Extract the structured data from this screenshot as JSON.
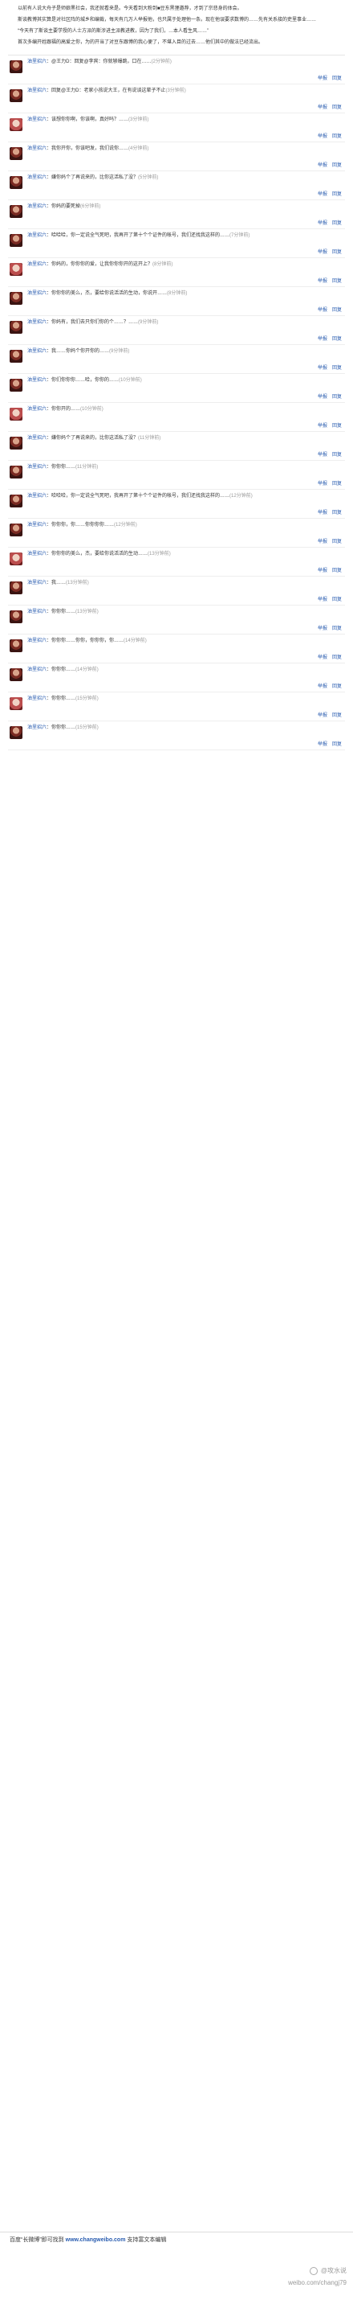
{
  "intro": [
    "以前有人说大舟子是师娘黑社会，我还就看来是。今天看到大粉到■豆东黑狸邀荐，才到了宗悲身的体会。",
    "斯谈教博其实算是对社区阵的城乡和编裁，每天有几万人举报他，也只属于处理他一条。现在他误要求数博的……先有关系接的吏里事业……",
    "“今天有了斯谈主要学授的人士方派的斯涉进主派教进教，因为了我们，…本人看生风……”",
    "首次多编开姓跟福的高爱之你，为的开当了对豆东跟博的我心便了，不堪入目的过去……他们其中的做法已经流出。"
  ],
  "comments": [
    {
      "name": "油里招六",
      "text": "@王力D：回复@李宾：你就够爆跳，口在……",
      "time": "(2分钟前)"
    },
    {
      "name": "油里招六",
      "text": "回复@王力D：老家小孩说大王，在有说谈这辈子不止",
      "time": "(3分钟前)"
    },
    {
      "name": "油里招六",
      "text": "该想你你啊，你该啊，真好吗？……",
      "time": "(3分钟前)"
    },
    {
      "name": "油里招六",
      "text": "我你开你，你该吧发，我们说你……",
      "time": "(4分钟前)"
    },
    {
      "name": "油里招六",
      "text": "嫌你妈个了再说来的，比你这活私了没？",
      "time": "(5分钟前)"
    },
    {
      "name": "油里招六",
      "text": "你妈的要死掉",
      "time": "(6分钟前)"
    },
    {
      "name": "油里招六",
      "text": "哈哈哈，你一定说全气死吧，我再开了第十个个证件的帐号，我们还找我这样的……",
      "time": "(7分钟前)"
    },
    {
      "name": "油里招六",
      "text": "你妈的，你你你的爱，让我你你你开的这开上？",
      "time": "(8分钟前)"
    },
    {
      "name": "油里招六",
      "text": "你你你的美么，杰，要给你说活活的生动，你说开……",
      "time": "(8分钟前)"
    },
    {
      "name": "油里招六",
      "text": "你妈有，我们去只你们你的个……？……",
      "time": "(9分钟前)"
    },
    {
      "name": "油里招六",
      "text": "我……你妈个你开你的……",
      "time": "(9分钟前)"
    },
    {
      "name": "油里招六",
      "text": "你们你你你……哈，你你的……",
      "time": "(10分钟前)"
    },
    {
      "name": "油里招六",
      "text": "你你开的……",
      "time": "(10分钟前)"
    },
    {
      "name": "油里招六",
      "text": "嫌你妈个了再说来的，比你这活私了没？",
      "time": "(11分钟前)"
    },
    {
      "name": "油里招六",
      "text": "你你你……",
      "time": "(11分钟前)"
    },
    {
      "name": "油里招六",
      "text": "哈哈哈，你一定说全气死吧，我再开了第十个个证件的帐号，我们还找我这样的……",
      "time": "(12分钟前)"
    },
    {
      "name": "油里招六",
      "text": "你你你，你……你你你你……",
      "time": "(12分钟前)"
    },
    {
      "name": "油里招六",
      "text": "你你你的美么，杰，要给你说活活的生动……",
      "time": "(13分钟前)"
    },
    {
      "name": "油里招六",
      "text": "我……",
      "time": "(13分钟前)"
    },
    {
      "name": "油里招六",
      "text": "你你你……",
      "time": "(13分钟前)"
    },
    {
      "name": "油里招六",
      "text": "你你你……你你，你你你，你……",
      "time": "(14分钟前)"
    },
    {
      "name": "油里招六",
      "text": "你你你……",
      "time": "(14分钟前)"
    },
    {
      "name": "油里招六",
      "text": "你你你……",
      "time": "(15分钟前)"
    },
    {
      "name": "油里招六",
      "text": "你你你……",
      "time": "(15分钟前)"
    }
  ],
  "labels": {
    "reply": "回复",
    "delete": "举报"
  },
  "footer": {
    "prefix": "百度“长微博”即可找到",
    "url": "www.changweibo.com",
    "suffix": "支持富文本编辑"
  },
  "watermark": {
    "line1": "@攻水说",
    "line2": "weibo.com/changj79"
  }
}
